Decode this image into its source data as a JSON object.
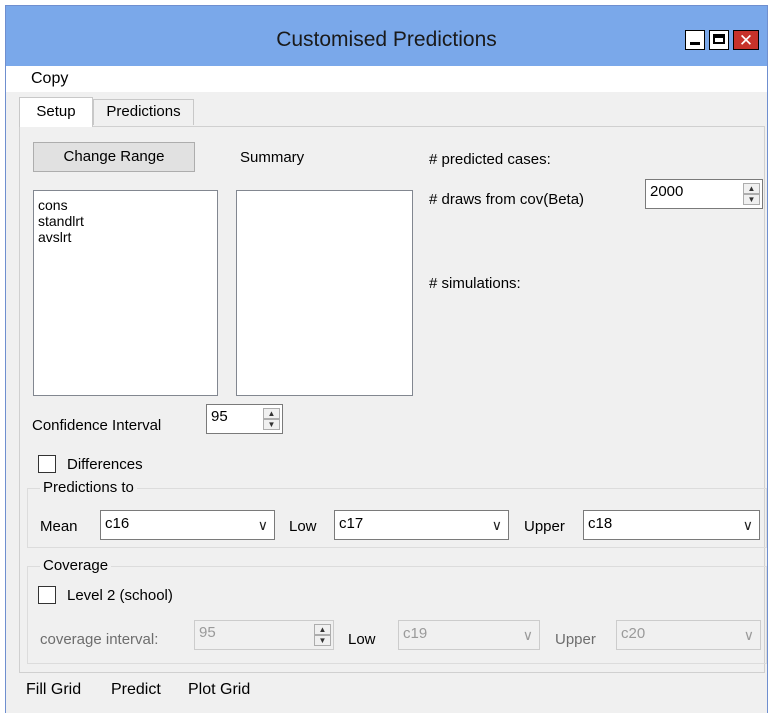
{
  "window": {
    "title": "Customised Predictions"
  },
  "menu": {
    "copy": "Copy"
  },
  "tabs": [
    {
      "label": "Setup",
      "active": true
    },
    {
      "label": "Predictions",
      "active": false
    }
  ],
  "setup": {
    "change_range_label": "Change Range",
    "summary_label": "Summary",
    "variables": [
      "cons",
      "standlrt",
      "avslrt"
    ],
    "predicted_cases_label": "# predicted cases:",
    "draws_label": "# draws from cov(Beta)",
    "draws_value": "2000",
    "simulations_label": "# simulations:",
    "confidence_interval_label": "Confidence Interval",
    "confidence_interval_value": "95",
    "differences_label": "Differences"
  },
  "predictions_to": {
    "title": "Predictions to",
    "mean_label": "Mean",
    "mean_value": "c16",
    "low_label": "Low",
    "low_value": "c17",
    "upper_label": "Upper",
    "upper_value": "c18"
  },
  "coverage": {
    "title": "Coverage",
    "level_label": "Level 2 (school)",
    "interval_label": "coverage interval:",
    "interval_value": "95",
    "low_label": "Low",
    "low_value": "c19",
    "upper_label": "Upper",
    "upper_value": "c20"
  },
  "bottom_menu": {
    "fill_grid": "Fill Grid",
    "predict": "Predict",
    "plot_grid": "Plot Grid"
  },
  "colors": {
    "titlebar": "#7aa8ea",
    "close_button": "#c7322a",
    "face": "#f0f0f0"
  }
}
